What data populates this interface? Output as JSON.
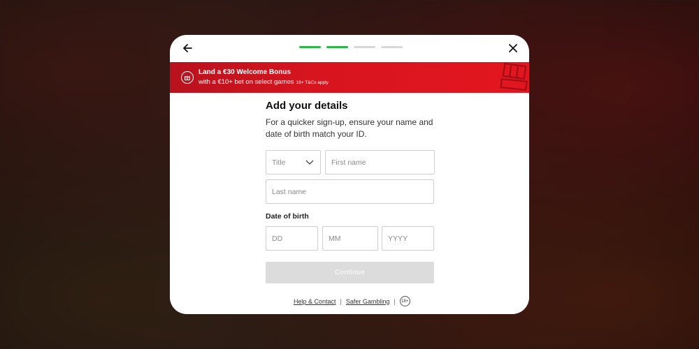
{
  "banner": {
    "title": "Land a €30 Welcome Bonus",
    "subtitle": "with a €10+ bet on select games",
    "terms": "18+ T&Cs apply"
  },
  "progress": {
    "total_steps": 4,
    "completed_steps": 2,
    "active_color": "#2eb84a"
  },
  "form": {
    "heading": "Add your details",
    "description": "For a quicker sign-up, ensure your name and date of birth match your ID.",
    "title_select": "Title",
    "first_name_placeholder": "First name",
    "last_name_placeholder": "Last name",
    "dob_label": "Date of birth",
    "day_placeholder": "DD",
    "month_placeholder": "MM",
    "year_placeholder": "YYYY",
    "continue_label": "Continue"
  },
  "footer": {
    "help_link": "Help & Contact",
    "safer_gambling_link": "Safer Gambling",
    "age_badge": "18+"
  },
  "icons": {
    "back": "arrow-left-icon",
    "close": "close-icon",
    "gift": "gift-icon",
    "dropdown": "chevron-down-icon"
  },
  "colors": {
    "banner_red": "#e3161f",
    "annotation_red": "#c8141c",
    "disabled_button": "#dcdcdc"
  }
}
